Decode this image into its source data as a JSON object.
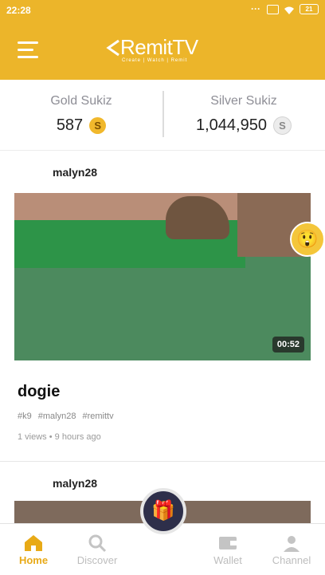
{
  "status_bar": {
    "time": "22:28",
    "overflow_icon": "dots",
    "battery": "21"
  },
  "header": {
    "logo_text": "RemitTV",
    "tagline": "Create | Watch | Remit",
    "brand_color": "#ecb52a"
  },
  "balance": {
    "gold": {
      "label": "Gold Sukiz",
      "value": "587",
      "coin": "S"
    },
    "silver": {
      "label": "Silver Sukiz",
      "value": "1,044,950",
      "coin": "S"
    }
  },
  "post": {
    "user": "malyn28",
    "duration": "00:52",
    "title": "dogie",
    "tags": [
      "#k9",
      "#malyn28",
      "#remittv"
    ],
    "views": "1 views",
    "time": "9 hours ago",
    "reaction_icon": "surprised-emoji-icon"
  },
  "post2": {
    "user": "malyn28"
  },
  "nav": {
    "items": [
      {
        "label": "Home",
        "icon": "home-icon"
      },
      {
        "label": "Discover",
        "icon": "search-icon"
      },
      {
        "label": "Wallet",
        "icon": "wallet-icon"
      },
      {
        "label": "Channel",
        "icon": "user-icon"
      }
    ],
    "active_color": "#e8aa17"
  }
}
